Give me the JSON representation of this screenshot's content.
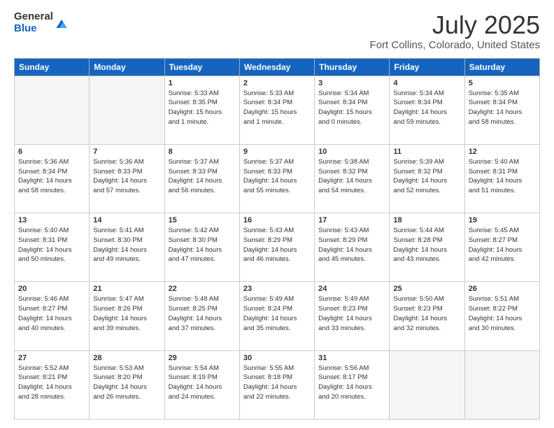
{
  "logo": {
    "general": "General",
    "blue": "Blue"
  },
  "header": {
    "month": "July 2025",
    "location": "Fort Collins, Colorado, United States"
  },
  "weekdays": [
    "Sunday",
    "Monday",
    "Tuesday",
    "Wednesday",
    "Thursday",
    "Friday",
    "Saturday"
  ],
  "weeks": [
    [
      {
        "day": "",
        "info": ""
      },
      {
        "day": "",
        "info": ""
      },
      {
        "day": "1",
        "info": "Sunrise: 5:33 AM\nSunset: 8:35 PM\nDaylight: 15 hours\nand 1 minute."
      },
      {
        "day": "2",
        "info": "Sunrise: 5:33 AM\nSunset: 8:34 PM\nDaylight: 15 hours\nand 1 minute."
      },
      {
        "day": "3",
        "info": "Sunrise: 5:34 AM\nSunset: 8:34 PM\nDaylight: 15 hours\nand 0 minutes."
      },
      {
        "day": "4",
        "info": "Sunrise: 5:34 AM\nSunset: 8:34 PM\nDaylight: 14 hours\nand 59 minutes."
      },
      {
        "day": "5",
        "info": "Sunrise: 5:35 AM\nSunset: 8:34 PM\nDaylight: 14 hours\nand 58 minutes."
      }
    ],
    [
      {
        "day": "6",
        "info": "Sunrise: 5:36 AM\nSunset: 8:34 PM\nDaylight: 14 hours\nand 58 minutes."
      },
      {
        "day": "7",
        "info": "Sunrise: 5:36 AM\nSunset: 8:33 PM\nDaylight: 14 hours\nand 57 minutes."
      },
      {
        "day": "8",
        "info": "Sunrise: 5:37 AM\nSunset: 8:33 PM\nDaylight: 14 hours\nand 56 minutes."
      },
      {
        "day": "9",
        "info": "Sunrise: 5:37 AM\nSunset: 8:33 PM\nDaylight: 14 hours\nand 55 minutes."
      },
      {
        "day": "10",
        "info": "Sunrise: 5:38 AM\nSunset: 8:32 PM\nDaylight: 14 hours\nand 54 minutes."
      },
      {
        "day": "11",
        "info": "Sunrise: 5:39 AM\nSunset: 8:32 PM\nDaylight: 14 hours\nand 52 minutes."
      },
      {
        "day": "12",
        "info": "Sunrise: 5:40 AM\nSunset: 8:31 PM\nDaylight: 14 hours\nand 51 minutes."
      }
    ],
    [
      {
        "day": "13",
        "info": "Sunrise: 5:40 AM\nSunset: 8:31 PM\nDaylight: 14 hours\nand 50 minutes."
      },
      {
        "day": "14",
        "info": "Sunrise: 5:41 AM\nSunset: 8:30 PM\nDaylight: 14 hours\nand 49 minutes."
      },
      {
        "day": "15",
        "info": "Sunrise: 5:42 AM\nSunset: 8:30 PM\nDaylight: 14 hours\nand 47 minutes."
      },
      {
        "day": "16",
        "info": "Sunrise: 5:43 AM\nSunset: 8:29 PM\nDaylight: 14 hours\nand 46 minutes."
      },
      {
        "day": "17",
        "info": "Sunrise: 5:43 AM\nSunset: 8:29 PM\nDaylight: 14 hours\nand 45 minutes."
      },
      {
        "day": "18",
        "info": "Sunrise: 5:44 AM\nSunset: 8:28 PM\nDaylight: 14 hours\nand 43 minutes."
      },
      {
        "day": "19",
        "info": "Sunrise: 5:45 AM\nSunset: 8:27 PM\nDaylight: 14 hours\nand 42 minutes."
      }
    ],
    [
      {
        "day": "20",
        "info": "Sunrise: 5:46 AM\nSunset: 8:27 PM\nDaylight: 14 hours\nand 40 minutes."
      },
      {
        "day": "21",
        "info": "Sunrise: 5:47 AM\nSunset: 8:26 PM\nDaylight: 14 hours\nand 39 minutes."
      },
      {
        "day": "22",
        "info": "Sunrise: 5:48 AM\nSunset: 8:25 PM\nDaylight: 14 hours\nand 37 minutes."
      },
      {
        "day": "23",
        "info": "Sunrise: 5:49 AM\nSunset: 8:24 PM\nDaylight: 14 hours\nand 35 minutes."
      },
      {
        "day": "24",
        "info": "Sunrise: 5:49 AM\nSunset: 8:23 PM\nDaylight: 14 hours\nand 33 minutes."
      },
      {
        "day": "25",
        "info": "Sunrise: 5:50 AM\nSunset: 8:23 PM\nDaylight: 14 hours\nand 32 minutes."
      },
      {
        "day": "26",
        "info": "Sunrise: 5:51 AM\nSunset: 8:22 PM\nDaylight: 14 hours\nand 30 minutes."
      }
    ],
    [
      {
        "day": "27",
        "info": "Sunrise: 5:52 AM\nSunset: 8:21 PM\nDaylight: 14 hours\nand 28 minutes."
      },
      {
        "day": "28",
        "info": "Sunrise: 5:53 AM\nSunset: 8:20 PM\nDaylight: 14 hours\nand 26 minutes."
      },
      {
        "day": "29",
        "info": "Sunrise: 5:54 AM\nSunset: 8:19 PM\nDaylight: 14 hours\nand 24 minutes."
      },
      {
        "day": "30",
        "info": "Sunrise: 5:55 AM\nSunset: 8:18 PM\nDaylight: 14 hours\nand 22 minutes."
      },
      {
        "day": "31",
        "info": "Sunrise: 5:56 AM\nSunset: 8:17 PM\nDaylight: 14 hours\nand 20 minutes."
      },
      {
        "day": "",
        "info": ""
      },
      {
        "day": "",
        "info": ""
      }
    ]
  ]
}
